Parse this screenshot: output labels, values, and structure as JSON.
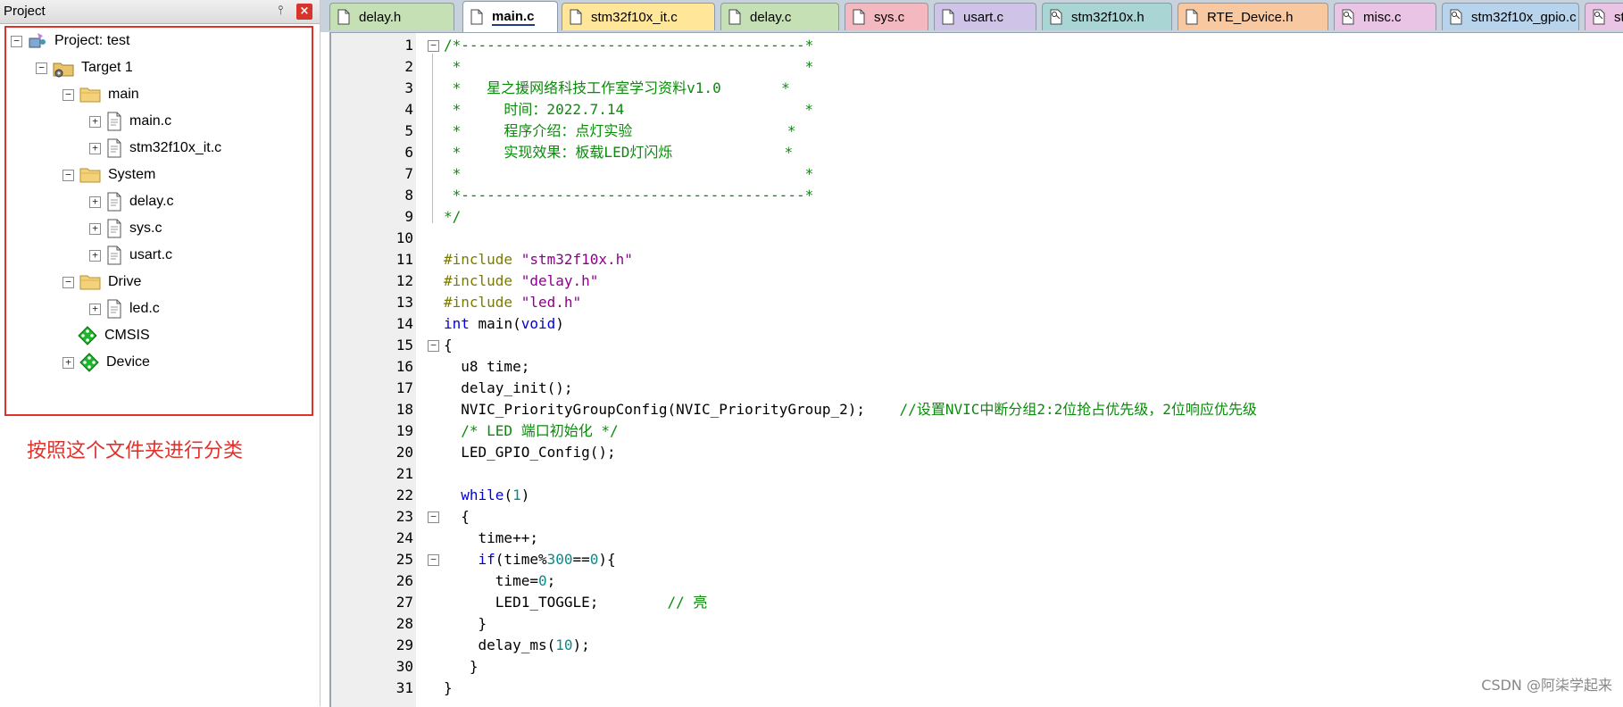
{
  "panel": {
    "title": "Project",
    "pin_glyph": "⫯",
    "close_glyph": "×"
  },
  "tree": [
    {
      "label": "Project: test",
      "icon": "project-icon",
      "expander": "−",
      "depth": 0
    },
    {
      "label": "Target 1",
      "icon": "target-folder-icon",
      "expander": "−",
      "depth": 1
    },
    {
      "label": "main",
      "icon": "folder-icon",
      "expander": "−",
      "depth": 2
    },
    {
      "label": "main.c",
      "icon": "c-file-icon",
      "expander": "+",
      "depth": 3
    },
    {
      "label": "stm32f10x_it.c",
      "icon": "c-file-icon",
      "expander": "+",
      "depth": 3
    },
    {
      "label": "System",
      "icon": "folder-icon",
      "expander": "−",
      "depth": 2
    },
    {
      "label": "delay.c",
      "icon": "c-file-icon",
      "expander": "+",
      "depth": 3
    },
    {
      "label": "sys.c",
      "icon": "c-file-icon",
      "expander": "+",
      "depth": 3
    },
    {
      "label": "usart.c",
      "icon": "c-file-icon",
      "expander": "+",
      "depth": 3
    },
    {
      "label": "Drive",
      "icon": "folder-icon",
      "expander": "−",
      "depth": 2
    },
    {
      "label": "led.c",
      "icon": "c-file-icon",
      "expander": "+",
      "depth": 3
    },
    {
      "label": "CMSIS",
      "icon": "green-component-icon",
      "expander": "",
      "depth": 2
    },
    {
      "label": "Device",
      "icon": "green-component-icon",
      "expander": "+",
      "depth": 2
    }
  ],
  "annotation": "按照这个文件夹进行分类",
  "tabs": [
    {
      "label": "delay.h",
      "color": "#c5e0b4",
      "active": false,
      "icon": "file-icon"
    },
    {
      "label": "main.c",
      "color": "#ffffff",
      "active": true,
      "icon": "file-icon"
    },
    {
      "label": "stm32f10x_it.c",
      "color": "#ffe699",
      "active": false,
      "icon": "file-icon"
    },
    {
      "label": "delay.c",
      "color": "#c5e0b4",
      "active": false,
      "icon": "file-icon"
    },
    {
      "label": "sys.c",
      "color": "#f4b8c0",
      "active": false,
      "icon": "file-icon"
    },
    {
      "label": "usart.c",
      "color": "#cfc4e8",
      "active": false,
      "icon": "file-icon"
    },
    {
      "label": "stm32f10x.h",
      "color": "#a9d5d5",
      "active": false,
      "icon": "key-file-icon"
    },
    {
      "label": "RTE_Device.h",
      "color": "#f8c8a0",
      "active": false,
      "icon": "file-icon"
    },
    {
      "label": "misc.c",
      "color": "#e9c4e4",
      "active": false,
      "icon": "key-file-icon"
    },
    {
      "label": "stm32f10x_gpio.c",
      "color": "#b8d4ec",
      "active": false,
      "icon": "key-file-icon"
    },
    {
      "label": "st",
      "color": "#e9c4e4",
      "active": false,
      "icon": "key-file-icon"
    }
  ],
  "code": [
    {
      "n": "1",
      "fold": "−",
      "parts": [
        {
          "t": "/*----------------------------------------*",
          "c": "c-comment"
        }
      ]
    },
    {
      "n": "2",
      "fold": "",
      "parts": [
        {
          "t": " *                                        *",
          "c": "c-comment"
        }
      ]
    },
    {
      "n": "3",
      "fold": "",
      "parts": [
        {
          "t": " *   星之援网络科技工作室学习资料v1.0       *",
          "c": "c-comment"
        }
      ]
    },
    {
      "n": "4",
      "fold": "",
      "parts": [
        {
          "t": " *     时间：2022.7.14                     *",
          "c": "c-comment"
        }
      ]
    },
    {
      "n": "5",
      "fold": "",
      "parts": [
        {
          "t": " *     程序介绍：点灯实验                  *",
          "c": "c-comment"
        }
      ]
    },
    {
      "n": "6",
      "fold": "",
      "parts": [
        {
          "t": " *     实现效果：板载LED灯闪烁             *",
          "c": "c-comment"
        }
      ]
    },
    {
      "n": "7",
      "fold": "",
      "parts": [
        {
          "t": " *                                        *",
          "c": "c-comment"
        }
      ]
    },
    {
      "n": "8",
      "fold": "",
      "parts": [
        {
          "t": " *----------------------------------------*",
          "c": "c-comment"
        }
      ]
    },
    {
      "n": "9",
      "fold": "",
      "parts": [
        {
          "t": "*/",
          "c": "c-comment"
        }
      ]
    },
    {
      "n": "10",
      "fold": "",
      "parts": []
    },
    {
      "n": "11",
      "fold": "",
      "parts": [
        {
          "t": "#include ",
          "c": "c-pre"
        },
        {
          "t": "\"stm32f10x.h\"",
          "c": "c-str"
        }
      ]
    },
    {
      "n": "12",
      "fold": "",
      "parts": [
        {
          "t": "#include ",
          "c": "c-pre"
        },
        {
          "t": "\"delay.h\"",
          "c": "c-str"
        }
      ]
    },
    {
      "n": "13",
      "fold": "",
      "parts": [
        {
          "t": "#include ",
          "c": "c-pre"
        },
        {
          "t": "\"led.h\"",
          "c": "c-str"
        }
      ]
    },
    {
      "n": "14",
      "fold": "",
      "parts": [
        {
          "t": "int",
          "c": "c-kw"
        },
        {
          "t": " main(",
          "c": ""
        },
        {
          "t": "void",
          "c": "c-kw"
        },
        {
          "t": ")",
          "c": ""
        }
      ]
    },
    {
      "n": "15",
      "fold": "−",
      "parts": [
        {
          "t": "{",
          "c": ""
        }
      ]
    },
    {
      "n": "16",
      "fold": "",
      "parts": [
        {
          "t": "  u8 time;",
          "c": ""
        }
      ]
    },
    {
      "n": "17",
      "fold": "",
      "parts": [
        {
          "t": "  delay_init();",
          "c": ""
        }
      ]
    },
    {
      "n": "18",
      "fold": "",
      "parts": [
        {
          "t": "  NVIC_PriorityGroupConfig(NVIC_PriorityGroup_2);    ",
          "c": ""
        },
        {
          "t": "//设置NVIC中断分组2:2位抢占优先级，2位响应优先级",
          "c": "c-comment"
        }
      ]
    },
    {
      "n": "19",
      "fold": "",
      "parts": [
        {
          "t": "  ",
          "c": ""
        },
        {
          "t": "/* LED 端口初始化 */",
          "c": "c-comment"
        }
      ]
    },
    {
      "n": "20",
      "fold": "",
      "parts": [
        {
          "t": "  LED_GPIO_Config();",
          "c": ""
        }
      ]
    },
    {
      "n": "21",
      "fold": "",
      "parts": []
    },
    {
      "n": "22",
      "fold": "",
      "parts": [
        {
          "t": "  ",
          "c": ""
        },
        {
          "t": "while",
          "c": "c-kw"
        },
        {
          "t": "(",
          "c": ""
        },
        {
          "t": "1",
          "c": "c-num"
        },
        {
          "t": ")",
          "c": ""
        }
      ]
    },
    {
      "n": "23",
      "fold": "−",
      "parts": [
        {
          "t": "  {",
          "c": ""
        }
      ]
    },
    {
      "n": "24",
      "fold": "",
      "parts": [
        {
          "t": "    time++;",
          "c": ""
        }
      ]
    },
    {
      "n": "25",
      "fold": "−",
      "parts": [
        {
          "t": "    ",
          "c": ""
        },
        {
          "t": "if",
          "c": "c-kw"
        },
        {
          "t": "(time%",
          "c": ""
        },
        {
          "t": "300",
          "c": "c-num"
        },
        {
          "t": "==",
          "c": ""
        },
        {
          "t": "0",
          "c": "c-num"
        },
        {
          "t": "){",
          "c": ""
        }
      ]
    },
    {
      "n": "26",
      "fold": "",
      "parts": [
        {
          "t": "      time=",
          "c": ""
        },
        {
          "t": "0",
          "c": "c-num"
        },
        {
          "t": ";",
          "c": ""
        }
      ]
    },
    {
      "n": "27",
      "fold": "",
      "parts": [
        {
          "t": "      LED1_TOGGLE;        ",
          "c": ""
        },
        {
          "t": "// 亮",
          "c": "c-comment"
        }
      ]
    },
    {
      "n": "28",
      "fold": "",
      "parts": [
        {
          "t": "    }",
          "c": ""
        }
      ]
    },
    {
      "n": "29",
      "fold": "",
      "parts": [
        {
          "t": "    delay_ms(",
          "c": ""
        },
        {
          "t": "10",
          "c": "c-num"
        },
        {
          "t": ");",
          "c": ""
        }
      ]
    },
    {
      "n": "30",
      "fold": "",
      "parts": [
        {
          "t": "   }",
          "c": ""
        }
      ]
    },
    {
      "n": "31",
      "fold": "",
      "parts": [
        {
          "t": "}",
          "c": ""
        }
      ]
    }
  ],
  "watermark": "CSDN @阿柒学起来"
}
